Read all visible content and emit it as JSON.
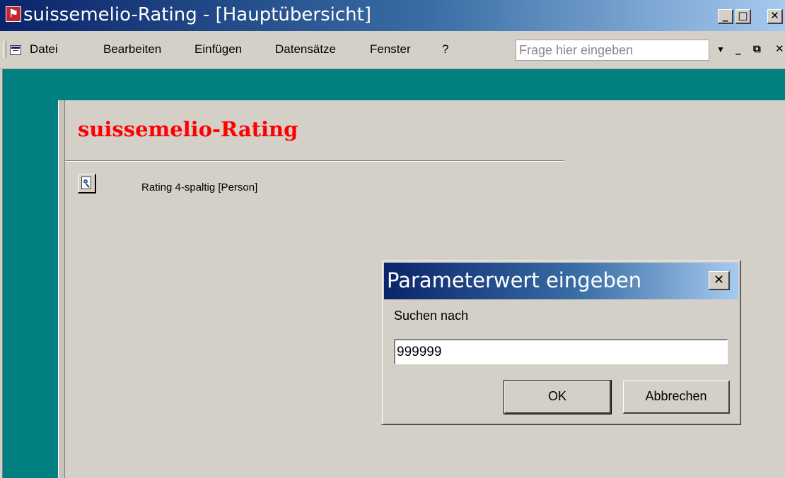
{
  "window": {
    "title": "suissemelio-Rating - [Hauptübersicht]",
    "controls": {
      "minimize": "_",
      "maximize": "□",
      "close": "✕"
    }
  },
  "menu": {
    "items": [
      "Datei",
      "Bearbeiten",
      "Einfügen",
      "Datensätze",
      "Fenster",
      "?"
    ],
    "help_placeholder": "Frage hier eingeben",
    "mdi_controls": {
      "dropdown": "▼",
      "minimize": "_",
      "restore": "⧉",
      "close": "✕"
    }
  },
  "form": {
    "title": "suissemelio-Rating",
    "title_color": "#ff0000",
    "items": [
      {
        "label": "Rating 4-spaltig [Person]",
        "icon": "report-preview-icon"
      }
    ]
  },
  "dialog": {
    "title": "Parameterwert eingeben",
    "prompt": "Suchen nach",
    "value": "999999",
    "ok_label": "OK",
    "cancel_label": "Abbrechen",
    "close_label": "✕"
  },
  "colors": {
    "titlebar_start": "#0a246a",
    "titlebar_end": "#a6caf0",
    "desktop_teal": "#008080",
    "face": "#d4d0c8"
  }
}
